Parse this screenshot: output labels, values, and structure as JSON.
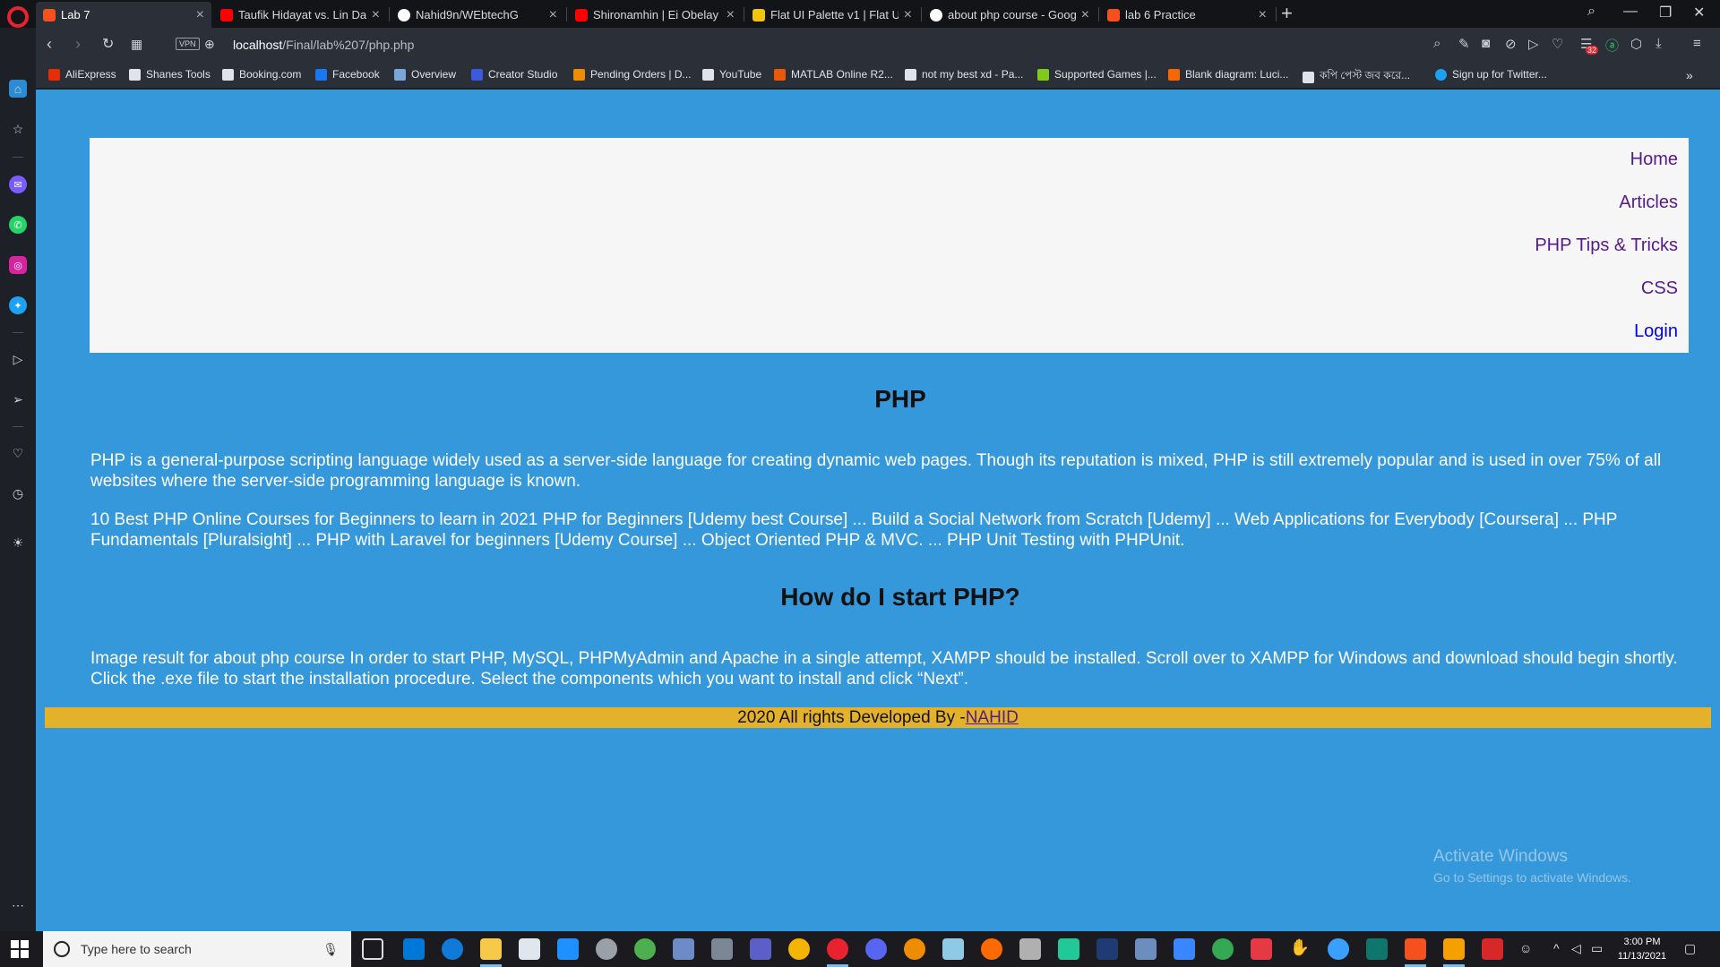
{
  "browser": {
    "tabs": [
      {
        "label": "Lab 7",
        "color": "#f4511e",
        "active": true
      },
      {
        "label": "Taufik Hidayat vs. Lin Dan a",
        "color": "#ff0000"
      },
      {
        "label": "Nahid9n/WEbtechG",
        "color": "#ffffff"
      },
      {
        "label": "Shironamhin | Ei Obelay | O",
        "color": "#ff0000"
      },
      {
        "label": "Flat UI Palette v1 | Flat U",
        "color": "#f1c40f"
      },
      {
        "label": "about php course - Google",
        "color": "#ffffff"
      },
      {
        "label": "lab 6 Practice",
        "color": "#f4511e"
      }
    ],
    "url": {
      "host": "localhost",
      "path": "/Final/lab%207/php.php"
    },
    "vpn_label": "VPN",
    "notification_count": "32",
    "bookmarks": [
      {
        "label": "AliExpress",
        "color": "#e62e04"
      },
      {
        "label": "Shanes Tools",
        "color": "#e0e3e7"
      },
      {
        "label": "Booking.com",
        "color": "#e0e3e7"
      },
      {
        "label": "Facebook",
        "color": "#1877f2"
      },
      {
        "label": "Overview",
        "color": "#7aa7d9"
      },
      {
        "label": "Creator Studio",
        "color": "#3b5bdb"
      },
      {
        "label": "Pending Orders | D...",
        "color": "#f08c00"
      },
      {
        "label": "YouTube",
        "color": "#e0e3e7"
      },
      {
        "label": "MATLAB Online R2...",
        "color": "#e8590c"
      },
      {
        "label": "not my best xd - Pa...",
        "color": "#e0e3e7"
      },
      {
        "label": "Supported Games |...",
        "color": "#82c91e"
      },
      {
        "label": "Blank diagram: Luci...",
        "color": "#f76707"
      },
      {
        "label": "কপি পেস্ট জব করে...",
        "color": "#e0e3e7"
      },
      {
        "label": "Sign up for Twitter...",
        "color": "#1da1f2"
      }
    ]
  },
  "page": {
    "nav": [
      "Home",
      "Articles",
      "PHP Tips & Tricks",
      "CSS",
      "Login"
    ],
    "heading1": "PHP",
    "para1": "PHP is a general-purpose scripting language widely used as a server-side language for creating dynamic web pages. Though its reputation is mixed, PHP is still extremely popular and is used in over 75% of all websites where the server-side programming language is known.",
    "para2": "10 Best PHP Online Courses for Beginners to learn in 2021 PHP for Beginners [Udemy best Course] ... Build a Social Network from Scratch [Udemy] ... Web Applications for Everybody [Coursera] ... PHP Fundamentals [Pluralsight] ... PHP with Laravel for beginners [Udemy Course] ... Object Oriented PHP & MVC. ... PHP Unit Testing with PHPUnit.",
    "heading2": "How do I start PHP?",
    "para3": "Image result for about php course In order to start PHP, MySQL, PHPMyAdmin and Apache in a single attempt, XAMPP should be installed. Scroll over to XAMPP for Windows and download should begin shortly. Click the .exe file to start the installation procedure. Select the components which you want to install and click “Next”.",
    "footer_text": "2020 All rights Developed By -",
    "footer_link": "NAHID",
    "colors": {
      "background": "#3498db",
      "nav_bg": "#f6f6f6",
      "footer_bg": "#e3b12a"
    }
  },
  "watermark": {
    "line1": "Activate Windows",
    "line2": "Go to Settings to activate Windows."
  },
  "taskbar": {
    "search_placeholder": "Type here to search",
    "time": "3:00 PM",
    "date": "11/13/2021"
  }
}
